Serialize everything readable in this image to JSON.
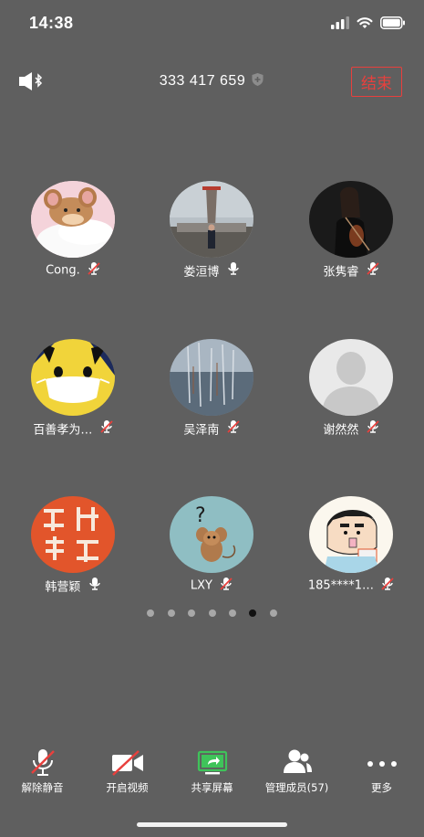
{
  "status_bar": {
    "time": "14:38"
  },
  "meeting": {
    "id": "333 417 659",
    "end_label": "结束"
  },
  "participants": [
    {
      "name": "Cong.",
      "mic": "muted",
      "avatar": "cartoon-mouse-avatar"
    },
    {
      "name": "娄洹博",
      "mic": "on",
      "avatar": "person-monument-avatar"
    },
    {
      "name": "张隽睿",
      "mic": "muted",
      "avatar": "violinist-avatar"
    },
    {
      "name": "百善孝为…",
      "mic": "muted",
      "avatar": "pikachu-mask-avatar"
    },
    {
      "name": "吴泽南",
      "mic": "muted",
      "avatar": "trees-reflection-avatar"
    },
    {
      "name": "谢然然",
      "mic": "muted",
      "avatar": "default-person-avatar"
    },
    {
      "name": "韩营颖",
      "mic": "on",
      "avatar": "red-seal-avatar"
    },
    {
      "name": "LXY",
      "mic": "muted",
      "avatar": "mouse-question-avatar"
    },
    {
      "name": "185****1…",
      "mic": "muted",
      "avatar": "crayon-boy-avatar"
    }
  ],
  "pagination": {
    "total": 7,
    "active": 6
  },
  "toolbar": {
    "unmute": "解除静音",
    "start_video": "开启视频",
    "share_screen": "共享屏幕",
    "manage_members": "管理成员(57)",
    "more": "更多"
  },
  "colors": {
    "background": "#5f5f5f",
    "end_red": "#e8403d",
    "share_green": "#3fc35a",
    "mute_red": "#e8403d"
  }
}
